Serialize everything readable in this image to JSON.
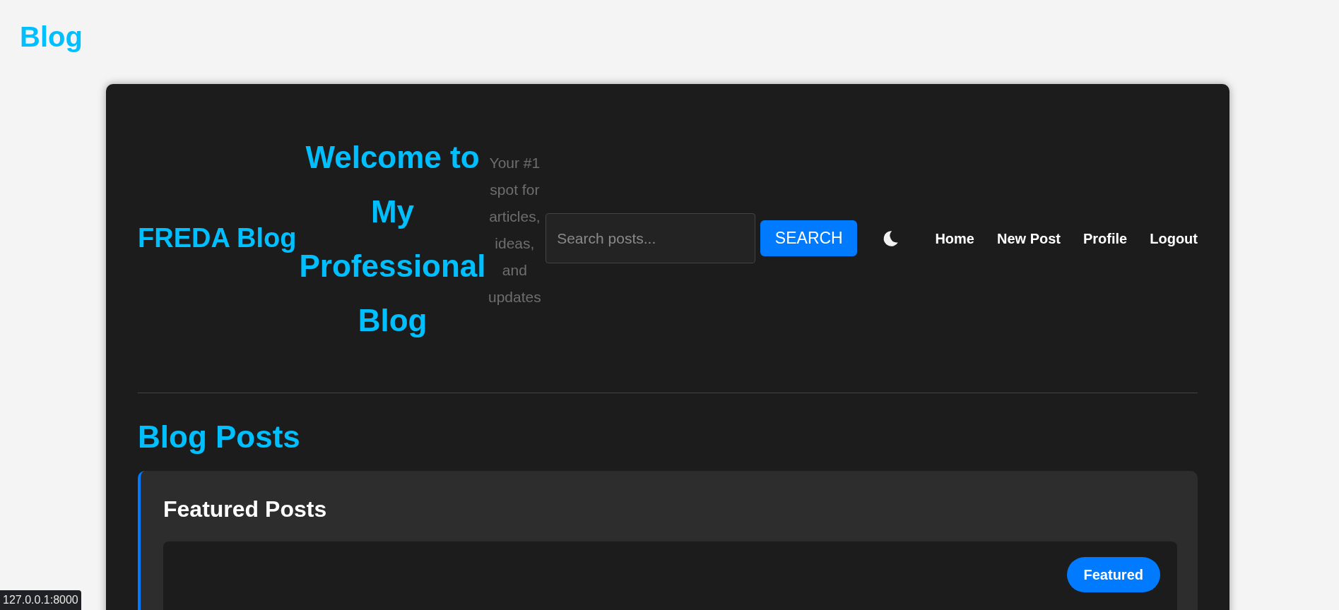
{
  "page_title": "Blog",
  "header": {
    "brand": "FREDA Blog",
    "heading": "Welcome to My Professional Blog",
    "tagline": "Your #1 spot for articles, ideas, and updates",
    "search": {
      "placeholder": "Search posts..."
    },
    "search_button": "SEARCH",
    "nav": [
      {
        "label": "Home"
      },
      {
        "label": "New Post"
      },
      {
        "label": "Profile"
      },
      {
        "label": "Logout"
      }
    ]
  },
  "section_title": "Blog Posts",
  "featured": {
    "title": "Featured Posts",
    "posts": [
      {
        "badge": "Featured"
      }
    ]
  },
  "status_bar": "127.0.0.1:8000"
}
